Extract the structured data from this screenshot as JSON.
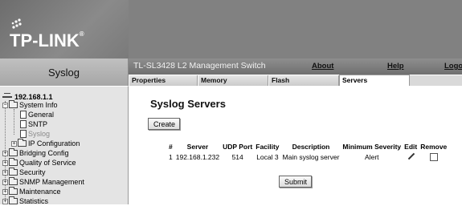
{
  "brand": {
    "logo_text": "TP-LINK",
    "trademark": "®"
  },
  "page_title": "Syslog",
  "topbar": {
    "switch_title": "TL-SL3428 L2 Management Switch",
    "links": {
      "about": "About",
      "help": "Help",
      "logout": "Logou"
    }
  },
  "tabs": [
    {
      "label": "Properties",
      "active": false
    },
    {
      "label": "Memory",
      "active": false
    },
    {
      "label": "Flash",
      "active": false
    },
    {
      "label": "Servers",
      "active": true
    }
  ],
  "tree": {
    "root": "192.168.1.1",
    "system_info": "System Info",
    "general": "General",
    "sntp": "SNTP",
    "syslog": "Syslog",
    "ip_config": "IP Configuration",
    "bridging": "Bridging Config",
    "qos": "Quality of Service",
    "security": "Security",
    "snmp": "SNMP Management",
    "maintenance": "Maintenance",
    "statistics": "Statistics"
  },
  "main": {
    "heading": "Syslog Servers",
    "create_label": "Create",
    "submit_label": "Submit",
    "columns": [
      "#",
      "Server",
      "UDP Port",
      "Facility",
      "Description",
      "Minimum Severity",
      "Edit",
      "Remove"
    ],
    "rows": [
      {
        "index": "1",
        "server": "192.168.1.232",
        "udp_port": "514",
        "facility": "Local 3",
        "description": "Main syslog server",
        "min_severity": "Alert",
        "remove_checked": false
      }
    ]
  },
  "colors": {
    "banner": "#818181",
    "sidebar": "#e4e4e4",
    "topbar": "#7f7f7f"
  }
}
